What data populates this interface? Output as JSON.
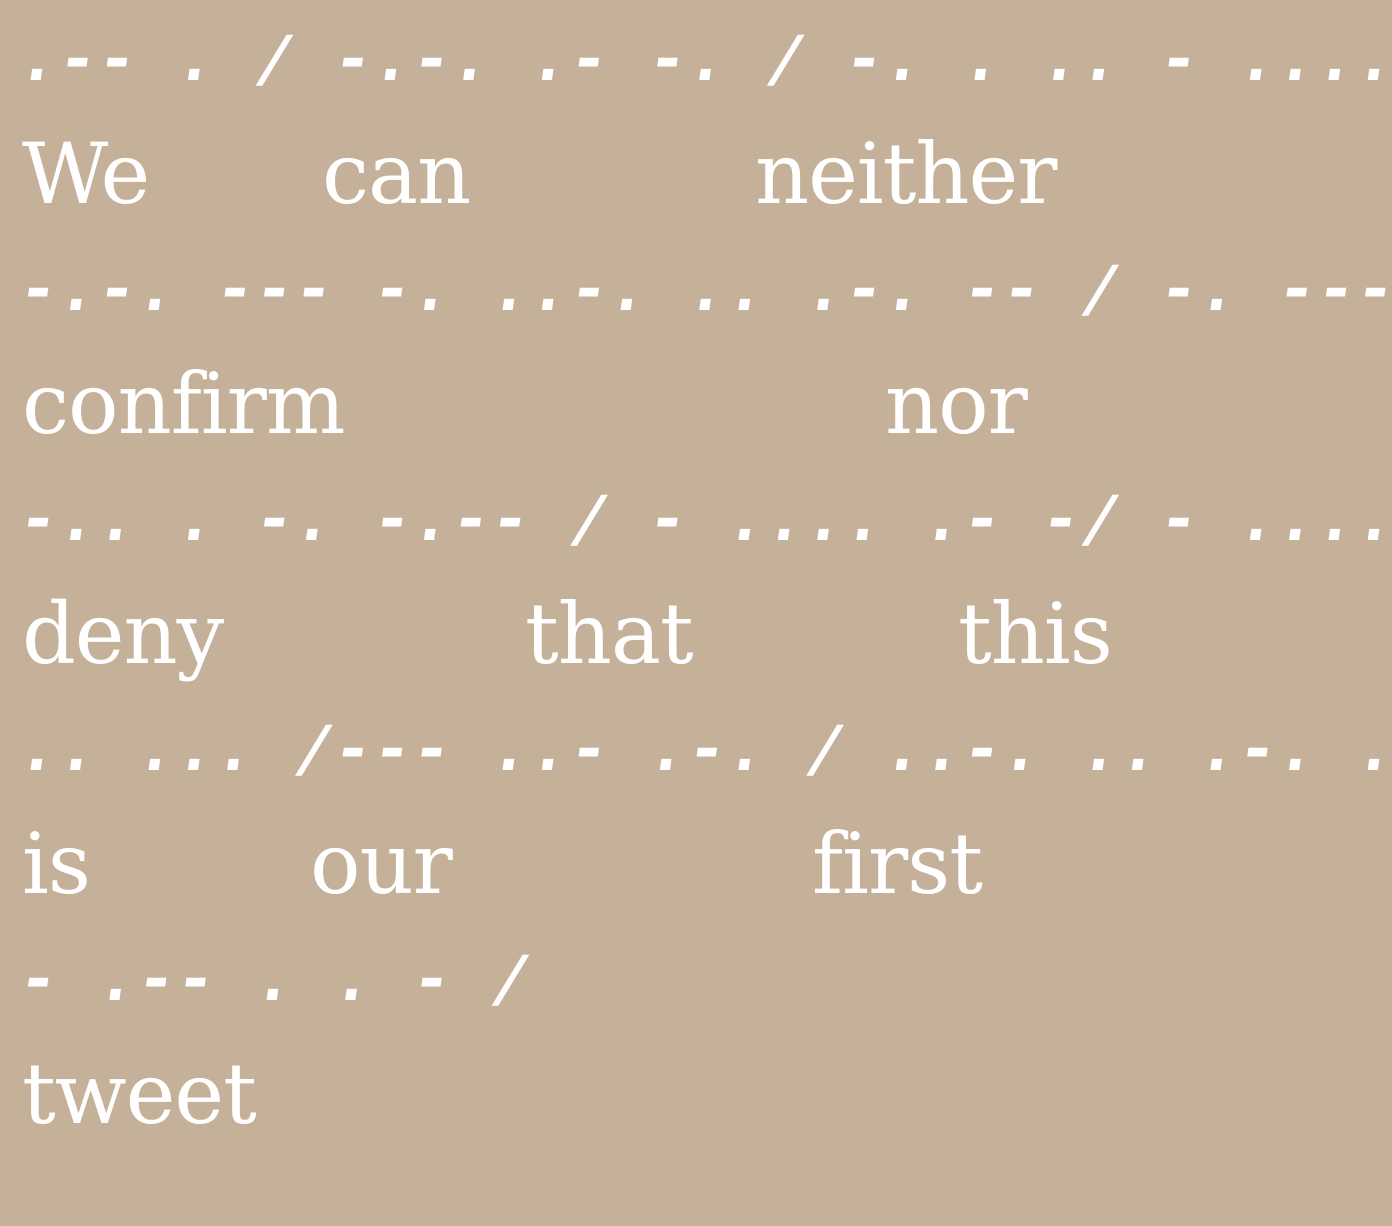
{
  "morse_lines": [
    ".-- . / -.-. .- -. / -. . .. - .... . .-. /",
    "-.-. --- -. ..-. .. .-. -- / -. --- .-. /",
    "-.. . -. -.-- / - .... .- -/ - .... .. ... /",
    ".. ... /--- ..- .-. / ..-. .. .-. ... - /",
    "- .-- . . - /"
  ],
  "words": {
    "w1": "We",
    "w2": "can",
    "w3": "neither",
    "w4": "confirm",
    "w5": "nor",
    "w6": "deny",
    "w7": "that",
    "w8": "this",
    "w9": "is",
    "w10": "our",
    "w11": "first",
    "w12": "tweet"
  },
  "colors": {
    "background": "#c5b19a",
    "text": "#ffffff"
  }
}
